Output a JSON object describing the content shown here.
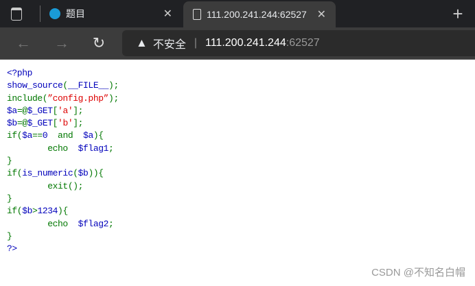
{
  "colors": {
    "html": "#0000BB",
    "keyword": "#007700",
    "string": "#DD0000"
  },
  "tabs": [
    {
      "title": "题目",
      "icon": "site-logo-icon"
    },
    {
      "title": "111.200.241.244:62527",
      "icon": "page-icon"
    }
  ],
  "address": {
    "security_label": "不安全",
    "host": "111.200.241.244",
    "port": ":62527"
  },
  "code_lines": [
    [
      [
        "<?php",
        "h"
      ]
    ],
    [
      [
        "show_source",
        "h"
      ],
      [
        "(",
        "k"
      ],
      [
        "__FILE__",
        "h"
      ],
      [
        ");",
        "k"
      ]
    ],
    [
      [
        "include(",
        "k"
      ],
      [
        "”config.php”",
        "s"
      ],
      [
        ");",
        "k"
      ]
    ],
    [
      [
        "$a",
        "h"
      ],
      [
        "=@",
        "k"
      ],
      [
        "$_GET",
        "h"
      ],
      [
        "[",
        "k"
      ],
      [
        "'a'",
        "s"
      ],
      [
        "];",
        "k"
      ]
    ],
    [
      [
        "$b",
        "h"
      ],
      [
        "=@",
        "k"
      ],
      [
        "$_GET",
        "h"
      ],
      [
        "[",
        "k"
      ],
      [
        "'b'",
        "s"
      ],
      [
        "];",
        "k"
      ]
    ],
    [
      [
        "if(",
        "k"
      ],
      [
        "$a",
        "h"
      ],
      [
        "==",
        "k"
      ],
      [
        "0",
        "h"
      ],
      [
        "  and  ",
        "k"
      ],
      [
        "$a",
        "h"
      ],
      [
        "){",
        "k"
      ]
    ],
    [
      [
        "        echo  ",
        "k"
      ],
      [
        "$flag1",
        "h"
      ],
      [
        ";",
        "k"
      ]
    ],
    [
      [
        "}",
        "k"
      ]
    ],
    [
      [
        "if(",
        "k"
      ],
      [
        "is_numeric",
        "h"
      ],
      [
        "(",
        "k"
      ],
      [
        "$b",
        "h"
      ],
      [
        ")){",
        "k"
      ]
    ],
    [
      [
        "        exit();",
        "k"
      ]
    ],
    [
      [
        "}",
        "k"
      ]
    ],
    [
      [
        "if(",
        "k"
      ],
      [
        "$b",
        "h"
      ],
      [
        ">",
        "k"
      ],
      [
        "1234",
        "h"
      ],
      [
        "){",
        "k"
      ]
    ],
    [
      [
        "        echo  ",
        "k"
      ],
      [
        "$flag2",
        "h"
      ],
      [
        ";",
        "k"
      ]
    ],
    [
      [
        "}",
        "k"
      ]
    ],
    [
      [
        "?>",
        "h"
      ]
    ]
  ],
  "watermark": "CSDN @不知名白帽"
}
